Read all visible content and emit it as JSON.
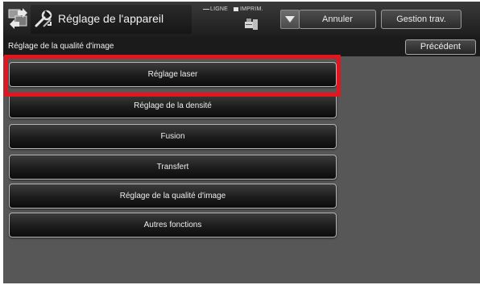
{
  "header": {
    "title": "Réglage de l'appareil",
    "status_line": "LIGNE",
    "status_print": "IMPRIM.",
    "cancel_label": "Annuler",
    "job_status_label": "Gestion trav."
  },
  "subheader": {
    "title": "Réglage de la qualité d'image",
    "back_label": "Précédent"
  },
  "menu": {
    "items": [
      {
        "label": "Réglage laser",
        "selected": true
      },
      {
        "label": "Réglage de la densité"
      },
      {
        "label": "Fusion"
      },
      {
        "label": "Transfert"
      },
      {
        "label": "Réglage de la qualité d'image"
      },
      {
        "label": "Autres fonctions"
      }
    ]
  },
  "colors": {
    "highlight": "#e5151f",
    "background": "#575757",
    "bar": "#1b1b1b"
  },
  "icons": [
    "home-icon",
    "tool-icon",
    "printer-icon",
    "chevron-down-icon"
  ]
}
